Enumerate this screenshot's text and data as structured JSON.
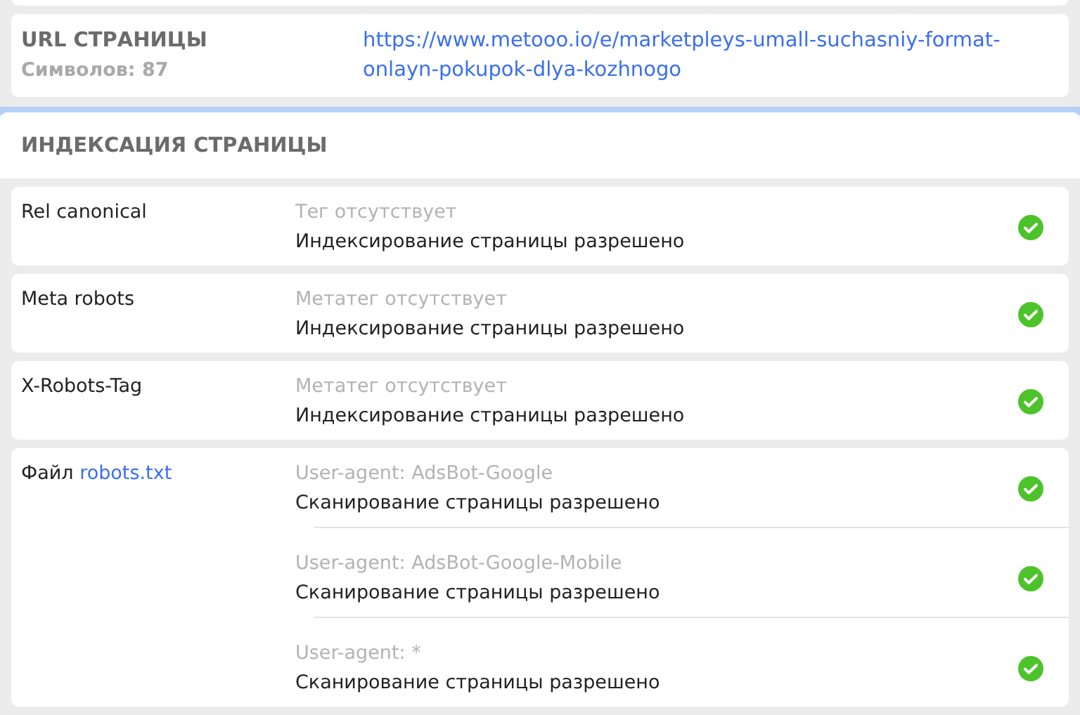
{
  "url": {
    "label": "URL СТРАНИЦЫ",
    "count": "Символов: 87",
    "value": "https://www.metooo.io/e/marketpleys-umall-suchasniy-format-onlayn-pokupok-dlya-kozhnogo"
  },
  "indexing": {
    "title": "ИНДЕКСАЦИЯ СТРАНИЦЫ",
    "rows": [
      {
        "label": "Rel canonical",
        "entries": [
          {
            "note": "Тег отсутствует",
            "result": "Индексирование страницы разрешено",
            "passed": true
          }
        ]
      },
      {
        "label": "Meta robots",
        "entries": [
          {
            "note": "Метатег отсутствует",
            "result": "Индексирование страницы разрешено",
            "passed": true
          }
        ]
      },
      {
        "label": "X-Robots-Tag",
        "entries": [
          {
            "note": "Метатег отсутствует",
            "result": "Индексирование страницы разрешено",
            "passed": true
          }
        ]
      },
      {
        "label": "Файл",
        "link": "robots.txt",
        "entries": [
          {
            "note": "User-agent: AdsBot-Google",
            "result": "Сканирование страницы разрешено",
            "passed": true
          },
          {
            "note": "User-agent: AdsBot-Google-Mobile",
            "result": "Сканирование страницы разрешено",
            "passed": true
          },
          {
            "note": "User-agent: *",
            "result": "Сканирование страницы разрешено",
            "passed": true
          }
        ]
      }
    ]
  }
}
